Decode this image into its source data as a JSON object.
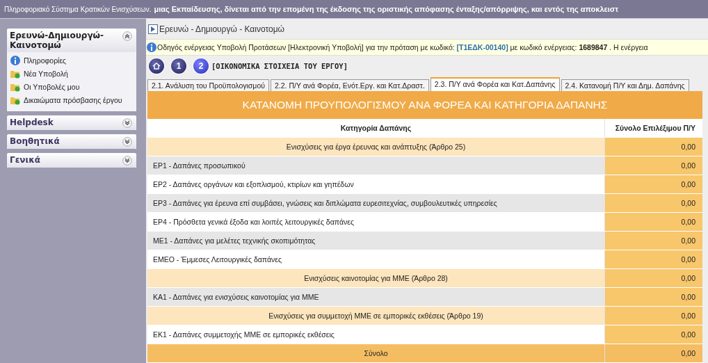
{
  "banner": {
    "lead": "Πληροφοριακό Σύστημα Κρατικών Ενισχύσεων.",
    "scroll": "μιας Εκπαίδευσης, δίνεται από την επομένη της έκδοσης της οριστικής απόφασης ένταξης/απόρριψης, και εντός της αποκλειστ"
  },
  "sidebar": [
    {
      "title": "Ερευνώ-Δημιουργώ-Καινοτομώ",
      "expanded": true,
      "items": [
        {
          "label": "Πληροφορίες",
          "kind": "info"
        },
        {
          "label": "Νέα Υποβολή",
          "kind": "folder"
        },
        {
          "label": "Οι Υποβολές μου",
          "kind": "folder"
        },
        {
          "label": "Δικαιώματα πρόσβασης έργου",
          "kind": "folder"
        }
      ]
    },
    {
      "title": "Helpdesk",
      "expanded": false
    },
    {
      "title": "Βοηθητικά",
      "expanded": false
    },
    {
      "title": "Γενικά",
      "expanded": false
    }
  ],
  "breadcrumb": "Ερευνώ - Δημιουργώ - Καινοτομώ",
  "info": [
    {
      "kind": "text",
      "text": "Οδηγός ενέργειας Υποβολή Προτάσεων [Ηλεκτρονική Υποβολή] για την πρόταση με κωδικό:"
    },
    {
      "kind": "code",
      "text": "[Τ1ΕΔΚ-00140]"
    },
    {
      "kind": "text",
      "text": "με κωδικό ενέργειας:"
    },
    {
      "kind": "number",
      "text": "1689847"
    },
    {
      "kind": "text",
      "text": ". Η ενέργεια"
    }
  ],
  "steps": [
    {
      "kind": "home",
      "selected": false
    },
    {
      "kind": "step",
      "label": "1",
      "selected": false
    },
    {
      "kind": "step",
      "label": "2",
      "selected": true
    }
  ],
  "step_title": "[ΟΙΚΟΝΟΜΙΚΑ ΣΤΟΙΧΕΙΑ ΤΟΥ ΕΡΓΟΥ]",
  "tabs": [
    {
      "label": "2.1. Ανάλυση του Προϋπολογισμού",
      "selected": false
    },
    {
      "label": "2.2. Π/Υ ανά Φορέα, Ενότ.Εργ. και Κατ.Δραστ.",
      "selected": false
    },
    {
      "label": "2.3. Π/Υ ανά Φορέα και Κατ.Δαπάνης",
      "selected": true
    },
    {
      "label": "2.4. Κατανομή Π/Υ και Δημ. Δαπάνης",
      "selected": false
    }
  ],
  "table": {
    "title": "ΚΑΤΑΝΟΜΗ ΠΡΟΥΠΟΛΟΓΙΣΜΟΥ ΑΝΑ ΦΟΡΕΑ ΚΑΙ ΚΑΤΗΓΟΡΙΑ ΔΑΠΑΝΗΣ",
    "columns": [
      "Κατηγορία Δαπάνης",
      "Σύνολο Επιλέξιμου Π/Υ"
    ],
    "rows": [
      {
        "kind": "group",
        "label": "Ενισχύσεις για έργα έρευνας και ανάπτυξης (Άρθρο 25)",
        "value": "0,00"
      },
      {
        "kind": "item",
        "label": "ΕΡ1 - Δαπάνες προσωπικού",
        "value": "0,00"
      },
      {
        "kind": "item",
        "label": "ΕΡ2 - Δαπάνες οργάνων και εξοπλισμού, κτιρίων και γηπέδων",
        "value": "0,00"
      },
      {
        "kind": "item",
        "label": "ΕΡ3 - Δαπάνες για έρευνα επί συμβάσει, γνώσεις και διπλώματα ευρεσιτεχνίας, συμβουλευτικές υπηρεσίες",
        "value": "0,00"
      },
      {
        "kind": "item",
        "label": "ΕΡ4 - Πρόσθετα γενικά έξοδα και λοιπές λειτουργικές δαπάνες",
        "value": "0,00"
      },
      {
        "kind": "item",
        "label": "ΜΕ1 - Δαπάνες για μελέτες τεχνικής σκοπιμότητας",
        "value": "0,00"
      },
      {
        "kind": "item",
        "label": "ΕΜΕΟ - Έμμεσες Λειτουργικές δαπάνες",
        "value": "0,00"
      },
      {
        "kind": "group",
        "label": "Ενισχύσεις καινοτομίας για ΜΜΕ (Άρθρο 28)",
        "value": "0,00"
      },
      {
        "kind": "item",
        "label": "ΚΑ1 - Δαπάνες για ενισχύσεις καινοτομίας για ΜΜΕ",
        "value": "0,00"
      },
      {
        "kind": "group",
        "label": "Ενισχύσεις για συμμετοχή ΜΜΕ σε εμπορικές εκθέσεις (Άρθρο 19)",
        "value": "0,00"
      },
      {
        "kind": "item",
        "label": "ΕΚ1 - Δαπάνες συμμετοχής ΜΜΕ σε εμπορικές εκθέσεις",
        "value": "0,00"
      },
      {
        "kind": "total",
        "label": "Σύνολο",
        "value": "0,00"
      }
    ]
  }
}
